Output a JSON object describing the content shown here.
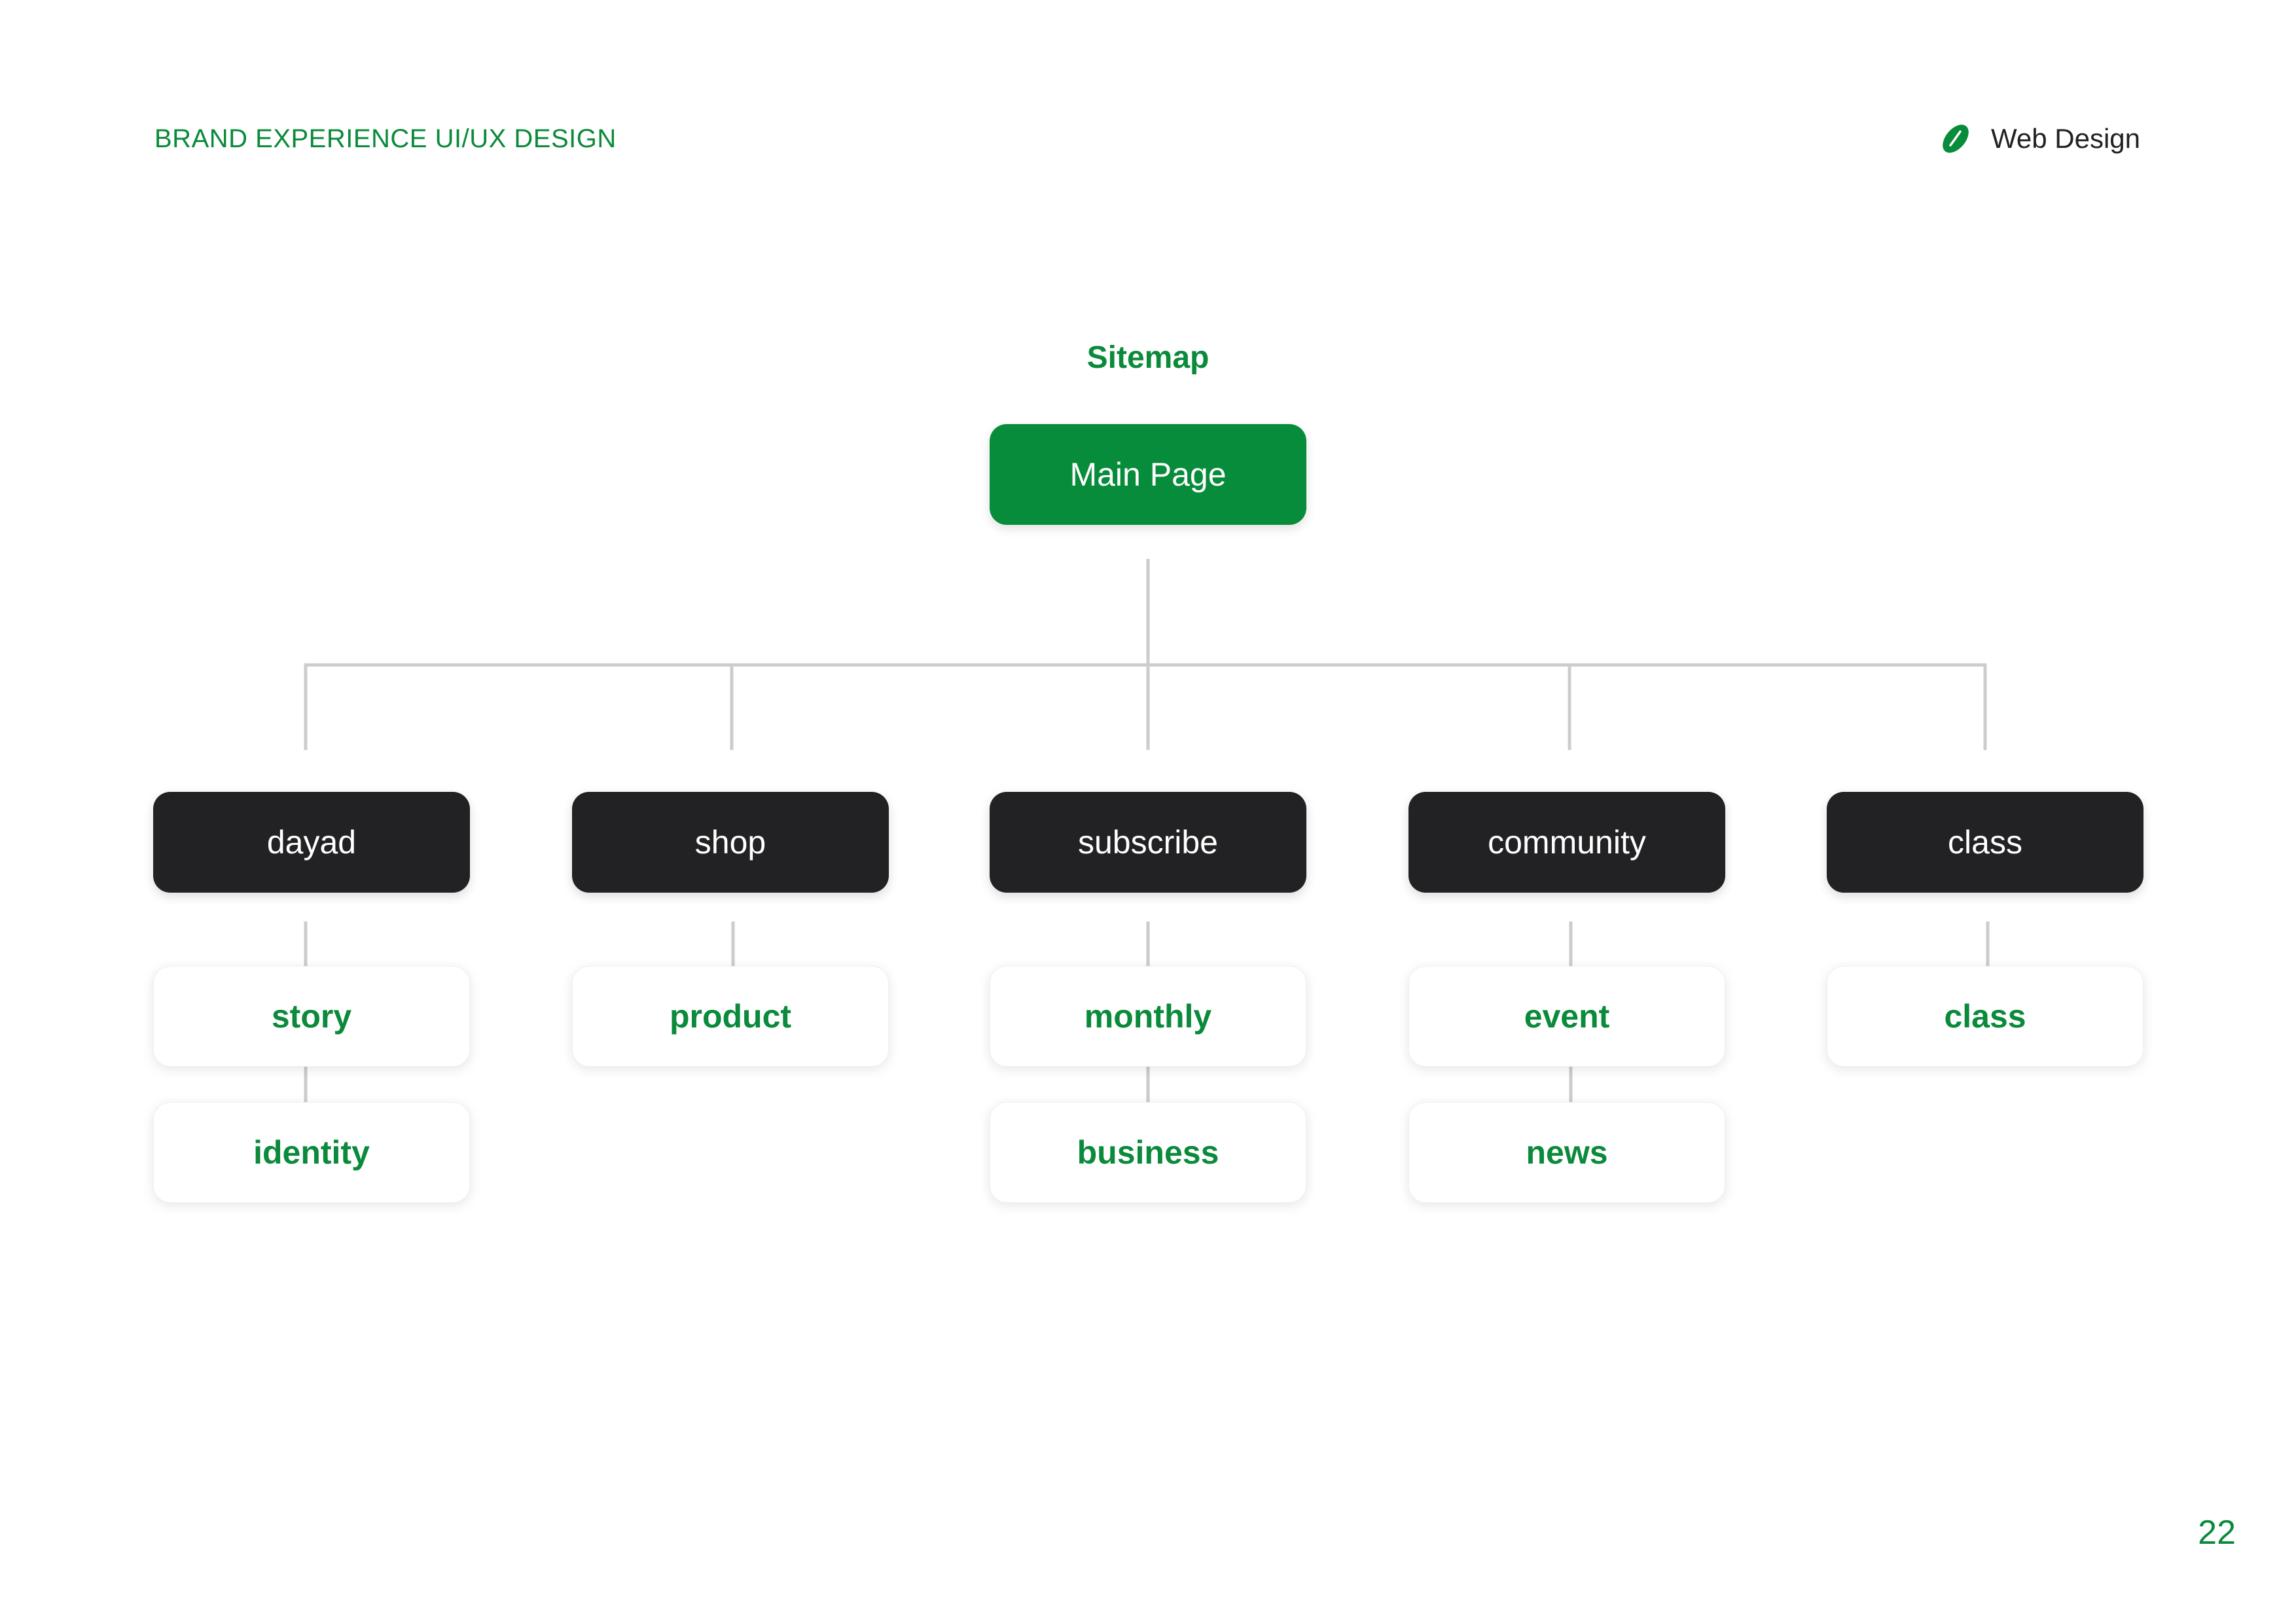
{
  "header": {
    "left_title": "BRAND EXPERIENCE UI/UX DESIGN",
    "right_label": "Web Design",
    "right_icon": "leaf-icon"
  },
  "sitemap": {
    "title": "Sitemap",
    "root": "Main Page",
    "branches": [
      {
        "label": "dayad",
        "children": [
          "story",
          "identity"
        ]
      },
      {
        "label": "shop",
        "children": [
          "product"
        ]
      },
      {
        "label": "subscribe",
        "children": [
          "monthly",
          "business"
        ]
      },
      {
        "label": "community",
        "children": [
          "event",
          "news"
        ]
      },
      {
        "label": "class",
        "children": [
          "class"
        ]
      }
    ]
  },
  "footer": {
    "page_number": "22"
  },
  "colors": {
    "brand_green": "#068c3b",
    "node_dark": "#222224",
    "connector": "#cccccc"
  }
}
